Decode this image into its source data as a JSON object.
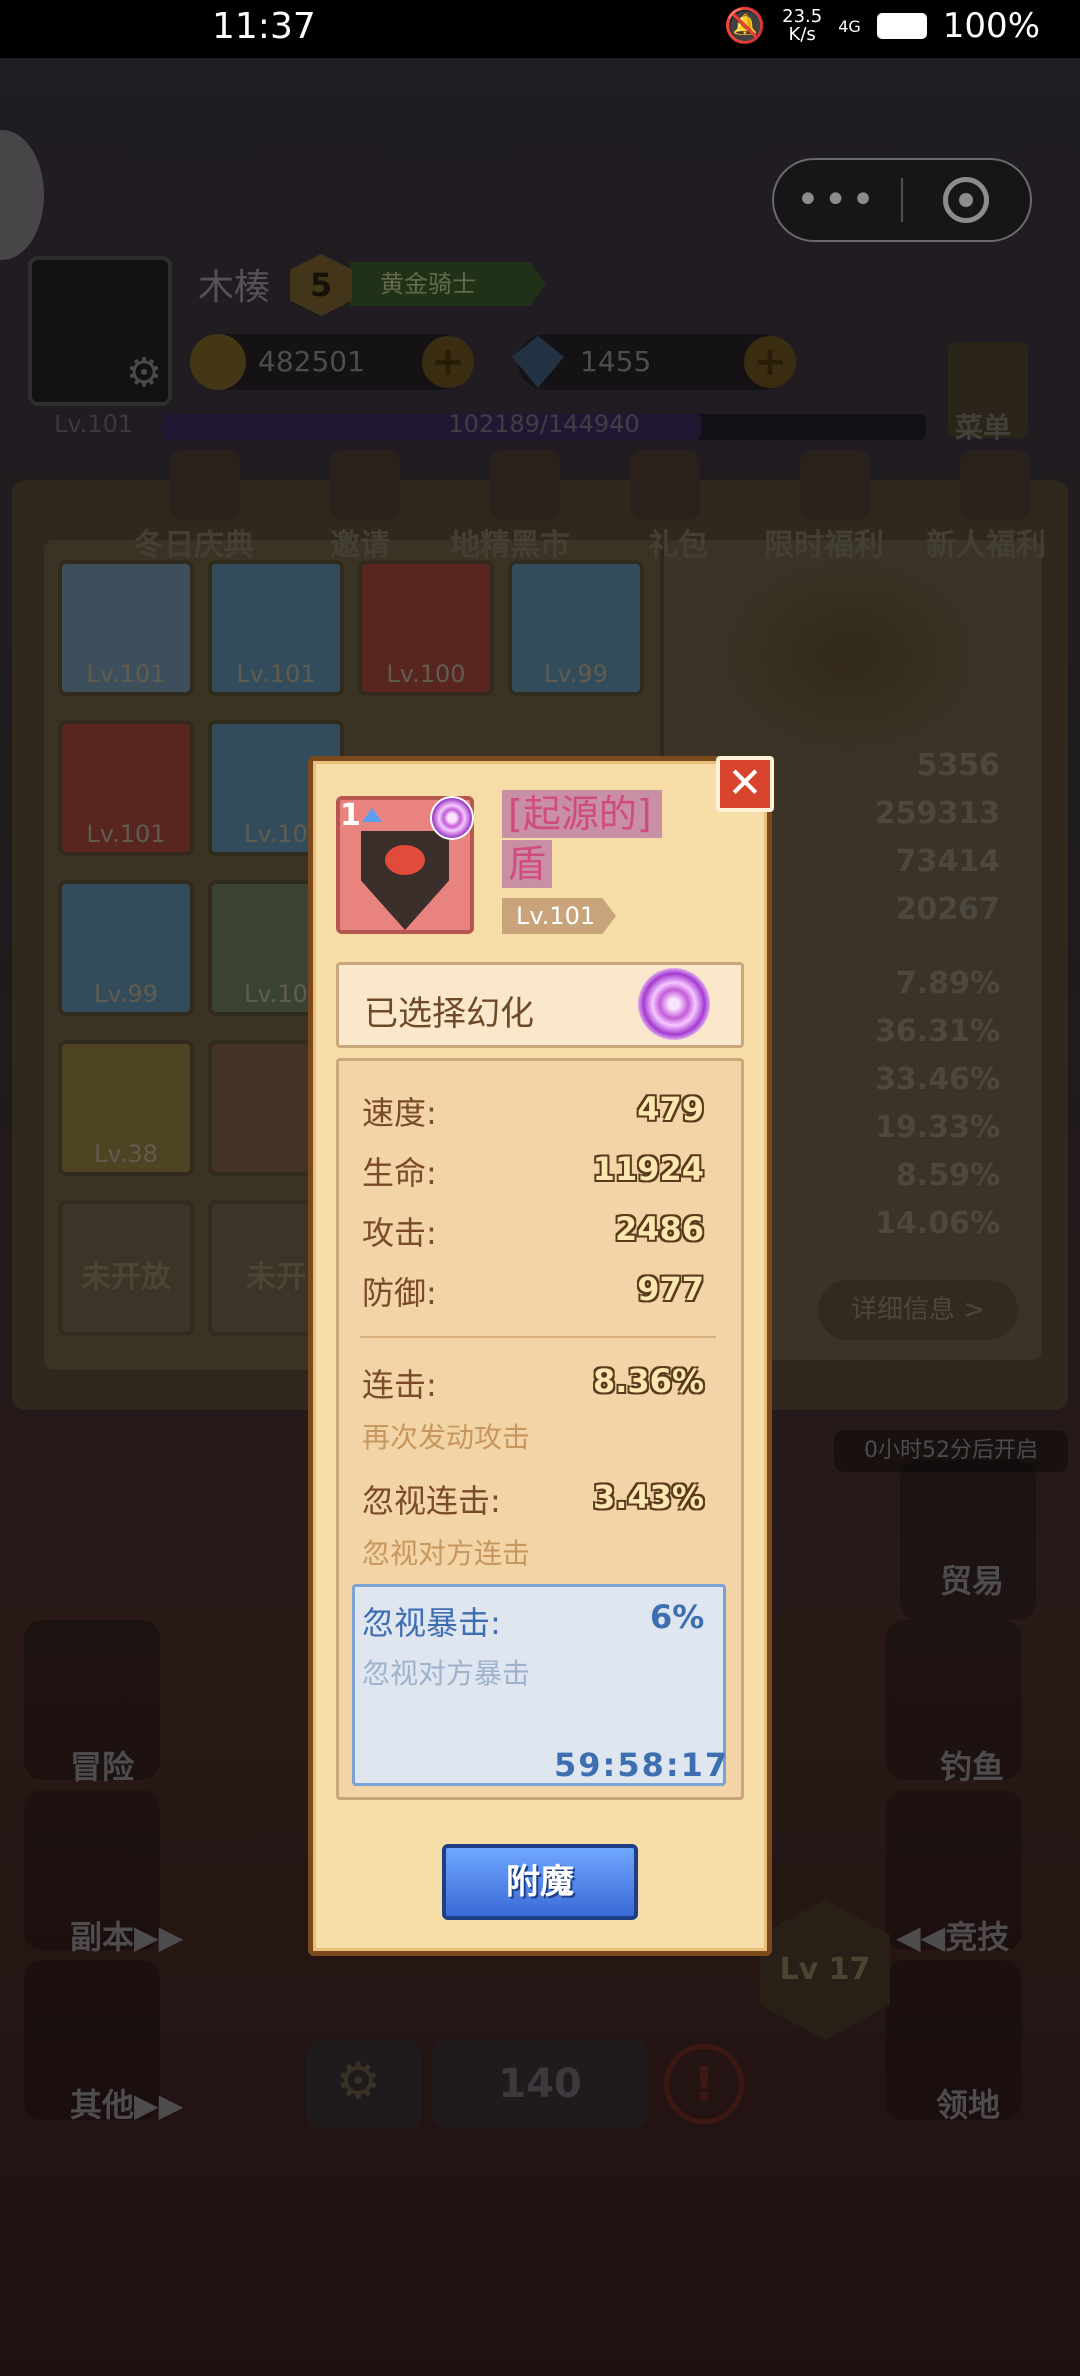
{
  "status_bar": {
    "time": "11:37",
    "net_speed_value": "23.5",
    "net_speed_unit": "K/s",
    "signal": "4G",
    "battery": "100%"
  },
  "player": {
    "name": "木楱",
    "rank_level": "5",
    "rank_title": "黄金骑士",
    "gold": "482501",
    "gems": "1455",
    "level_label": "Lv.101",
    "xp_text": "102189/144940",
    "xp_progress": 0.705
  },
  "menu_label": "菜单",
  "activities": [
    "冬日庆典",
    "邀请",
    "地精黑市",
    "礼包",
    "限时福利",
    "新人福利"
  ],
  "equipment_slots": [
    {
      "level": "Lv.101",
      "color": "#6f8fa8"
    },
    {
      "level": "Lv.101",
      "color": "#5d8aa6"
    },
    {
      "level": "Lv.100",
      "color": "#a2443a"
    },
    {
      "level": "Lv.99",
      "color": "#5d8aa6"
    },
    {
      "level": "Lv.101",
      "color": "#a2443a"
    },
    {
      "level": "Lv.10",
      "color": "#5d8aa6"
    },
    {
      "level": "Lv.99",
      "color": "#5d8aa6"
    },
    {
      "level": "Lv.10",
      "color": "#6b7a5c"
    },
    {
      "level": "Lv.38",
      "color": "#8f7a3e"
    },
    {
      "level": "",
      "color": "#7a5d45"
    }
  ],
  "locked_slot_label": "未开放",
  "locked_slot_label_cut": "未开",
  "background_stats": [
    "5356",
    "259313",
    "73414",
    "20267",
    "7.89%",
    "36.31%",
    "33.46%",
    "19.33%",
    "8.59%",
    "14.06%"
  ],
  "detail_button": "详细信息 >",
  "timer_note": "0小时52分后开启",
  "side_buttons_left": [
    "冒险",
    "副本▶▶",
    "其他▶▶"
  ],
  "side_buttons_right": [
    "贸易",
    "钓鱼",
    "◀◀竞技",
    "领地"
  ],
  "bottom_bar": {
    "count": "140"
  },
  "arena_level": "Lv 17",
  "modal": {
    "tier": "1",
    "item_name_line1": "[起源的]",
    "item_name_line2": "盾",
    "item_level": "Lv.101",
    "illusion_label": "已选择幻化",
    "stats": [
      {
        "label": "速度:",
        "value": "479"
      },
      {
        "label": "生命:",
        "value": "11924"
      },
      {
        "label": "攻击:",
        "value": "2486"
      },
      {
        "label": "防御:",
        "value": "977"
      }
    ],
    "special": [
      {
        "label": "连击:",
        "value": "8.36%",
        "desc": "再次发动攻击"
      },
      {
        "label": "忽视连击:",
        "value": "3.43%",
        "desc": "忽视对方连击"
      }
    ],
    "highlight": {
      "label": "忽视暴击:",
      "value": "6%",
      "desc": "忽视对方暴击",
      "timer": "59:58:17"
    },
    "enchant_button": "附魔",
    "close_symbol": "✕"
  }
}
